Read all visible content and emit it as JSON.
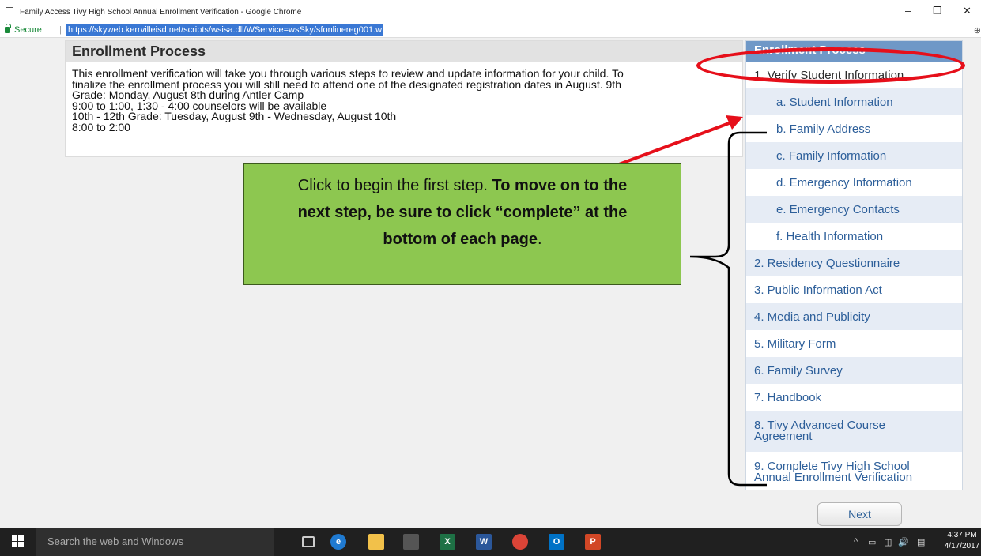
{
  "browser": {
    "window_title": "Family Access Tivy High School Annual Enrollment Verification - Google Chrome",
    "secure_label": "Secure",
    "separator": "|",
    "url": "https://skyweb.kerrvilleisd.net/scripts/wsisa.dll/WService=wsSky/sfonlinereg001.w",
    "minimize": "–",
    "restore": "❐",
    "close": "✕",
    "right_glyph": "⊕"
  },
  "enrollment": {
    "title": "Enrollment Process",
    "lines": [
      "This enrollment verification will take you through various steps to review and update information for your child. To",
      "finalize the enrollment process you will still need to attend one of the designated registration dates in August. 9th",
      "Grade: Monday, August 8th during Antler Camp",
      "9:00 to 1:00, 1:30 - 4:00 counselors will be available",
      "10th - 12th Grade: Tuesday, August 9th - Wednesday, August 10th",
      "8:00 to 2:00"
    ]
  },
  "sidebar": {
    "title": "Enrollment Process",
    "items": [
      {
        "label": "1. Verify Student Information"
      },
      {
        "label": "a. Student Information"
      },
      {
        "label": "b. Family Address"
      },
      {
        "label": "c. Family Information"
      },
      {
        "label": "d. Emergency Information"
      },
      {
        "label": "e. Emergency Contacts"
      },
      {
        "label": "f. Health Information"
      },
      {
        "label": "2. Residency Questionnaire"
      },
      {
        "label": "3. Public Information Act"
      },
      {
        "label": "4. Media and Publicity"
      },
      {
        "label": "5. Military Form"
      },
      {
        "label": "6. Family Survey"
      },
      {
        "label": "7. Handbook"
      },
      {
        "label": "8. Tivy Advanced Course Agreement"
      },
      {
        "label": "9. Complete Tivy High School Annual Enrollment Verification"
      }
    ]
  },
  "next_button": "Next",
  "callout": {
    "text_normal": "Click to begin the first step.",
    "text_bold_1": "To move on to the",
    "text_bold_2": "next step, be sure to click “complete” at the",
    "text_bold_3": "bottom of each page",
    "text_end": "."
  },
  "taskbar": {
    "search_placeholder": "Search the web and Windows",
    "time": "4:37 PM",
    "date": "4/17/2017",
    "tray_icons": [
      "^",
      "▭",
      "◫",
      "🔊",
      "▤"
    ]
  },
  "colors": {
    "sidebar_header": "#6f98c7",
    "sidebar_link": "#2d5f9a",
    "callout_bg": "#8dc750",
    "annotation_red": "#e60f1a",
    "url_highlight": "#3a78d4"
  }
}
